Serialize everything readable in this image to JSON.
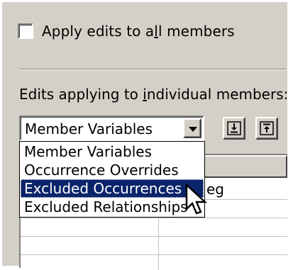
{
  "apply_all": {
    "label_pre": "Apply edits to a",
    "label_mnemonic": "l",
    "label_post": "l members",
    "checked": false
  },
  "edits_section": {
    "label_pre": "Edits applying to ",
    "label_mnemonic": "i",
    "label_post": "ndividual members:"
  },
  "combo": {
    "selected": "Member Variables",
    "options": [
      "Member Variables",
      "Occurrence Overrides",
      "Excluded Occurrences",
      "Excluded Relationships"
    ],
    "highlighted_option": "Excluded Occurrences"
  },
  "toolbar": {
    "import_icon": "import-arrow-icon",
    "export_icon": "export-arrow-icon"
  },
  "grid": {
    "partial_cell_text": "eg"
  },
  "colors": {
    "face": "#d4d0c8",
    "highlight": "#0a246a"
  }
}
